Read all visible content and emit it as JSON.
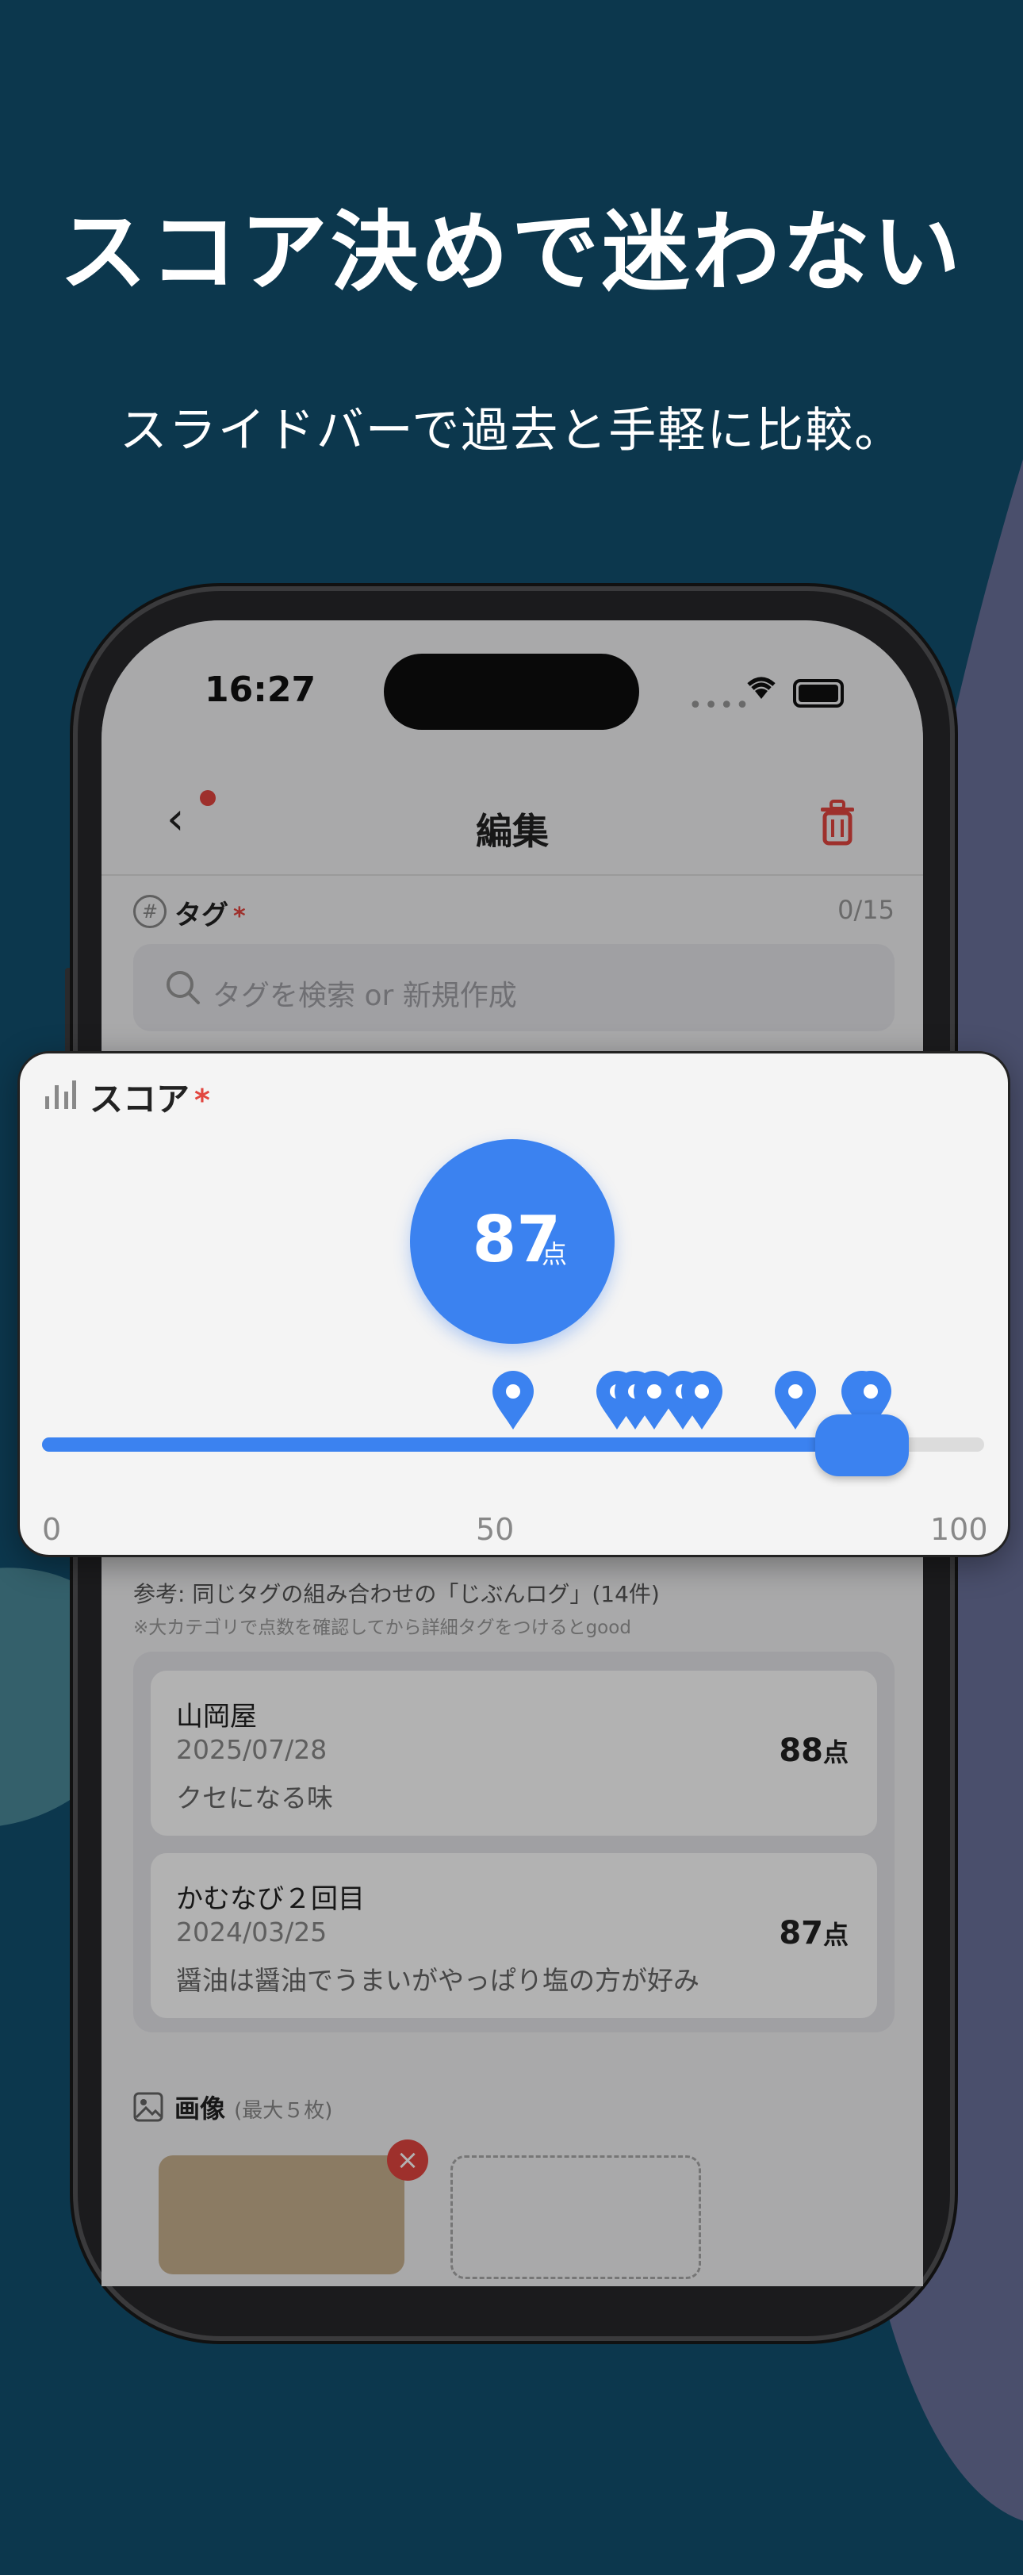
{
  "headline": "スコア決めで迷わない",
  "subline": "スライドバーで過去と手軽に比較。",
  "status_bar": {
    "time": "16:27"
  },
  "nav": {
    "title": "編集",
    "back_icon": "chevron-left-icon",
    "trash_icon": "trash-icon"
  },
  "tag": {
    "label": "タグ",
    "required_mark": "*",
    "count": "0/15",
    "search_placeholder": "タグを検索 or 新規作成"
  },
  "score": {
    "label": "スコア",
    "required_mark": "*",
    "value": "87",
    "unit": "点",
    "slider_value": 87,
    "slider_min": 0,
    "slider_max": 100,
    "axis_labels": [
      "0",
      "50",
      "100"
    ],
    "past_score_markers": [
      50,
      61,
      63,
      65,
      68,
      70,
      80,
      87,
      88
    ],
    "accent_color": "#3b82f0"
  },
  "reference": {
    "title": "参考: 同じタグの組み合わせの「じぶんログ」(14件)",
    "note": "※大カテゴリで点数を確認してから詳細タグをつけるとgood",
    "items": [
      {
        "name": "山岡屋",
        "date": "2025/07/28",
        "comment": "クセになる味",
        "score": "88",
        "unit": "点"
      },
      {
        "name": "かむなび２回目",
        "date": "2024/03/25",
        "comment": "醤油は醤油でうまいがやっぱり塩の方が好み",
        "score": "87",
        "unit": "点"
      }
    ]
  },
  "images": {
    "label": "画像",
    "sublabel": "(最大５枚)"
  }
}
